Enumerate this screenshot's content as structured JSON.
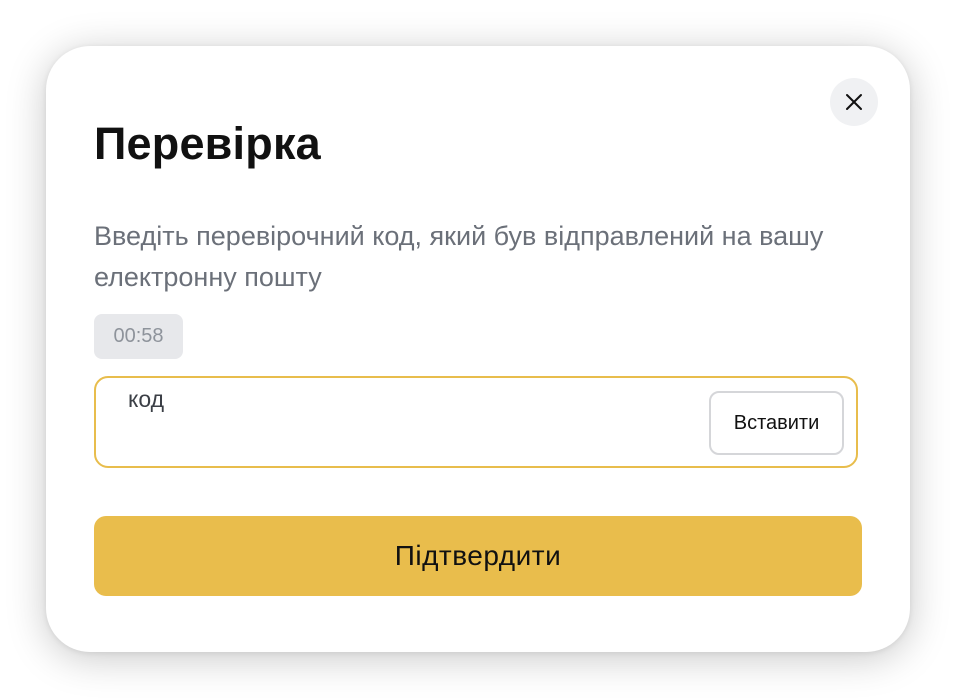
{
  "modal": {
    "title": "Перевірка",
    "description": "Введіть перевірочний код, який був відправлений на вашу електронну пошту",
    "timer": "00:58",
    "code_field": {
      "label": "код",
      "value": "",
      "paste_label": "Вставити"
    },
    "confirm_label": "Підтвердити",
    "close_icon": "close-icon"
  },
  "colors": {
    "accent": "#e9bd4c",
    "field_border": "#e8bd4c",
    "timer_bg": "#e7e8eb",
    "close_bg": "#f0f1f3",
    "description_text": "#6b7079"
  }
}
